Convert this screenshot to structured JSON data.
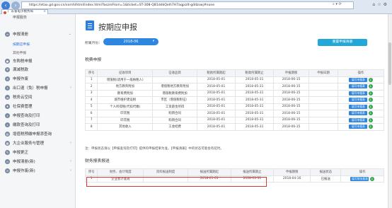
{
  "browser": {
    "url": "https://etax.gd.gov.cn/xxmh/html/index.html?bszmFrom=1&ticket=ST-308-Q81ddkQelh7H7aqpizlt-gddzswj#none",
    "tab_title": "广东省电子税务局",
    "back_icon": "back-arrow-icon",
    "forward_icon": "forward-arrow-icon"
  },
  "sidebar": {
    "top_label": "申报服务",
    "items": [
      {
        "label": "申报清册",
        "icon": "list-icon",
        "arrow": "⌄"
      },
      {
        "label": "按期应申报",
        "sub": true,
        "active": true
      },
      {
        "label": "其他申报",
        "sub": true,
        "active": false
      },
      {
        "label": "车购税申报",
        "icon": "car-icon"
      },
      {
        "label": "满减税款",
        "icon": "tax-icon"
      },
      {
        "label": "申报作废",
        "icon": "void-icon"
      },
      {
        "label": "出口退（免）税申报",
        "icon": "export-icon",
        "arrow": "›"
      },
      {
        "label": "税务云空间",
        "icon": "cloud-icon"
      },
      {
        "label": "社保费管理",
        "icon": "shield-icon"
      },
      {
        "label": "申报查询及打印",
        "icon": "search-icon"
      },
      {
        "label": "缴款查询及打印",
        "icon": "search-icon"
      },
      {
        "label": "增值税预缴申报添查询",
        "icon": "doc-icon"
      },
      {
        "label": "大企业服务与管理",
        "icon": "building-icon",
        "arrow": "›"
      },
      {
        "label": "申报更正",
        "icon": "edit-icon"
      },
      {
        "label": "申报清册(新)",
        "icon": "list-icon",
        "arrow": "›"
      },
      {
        "label": "申报作废(新)",
        "icon": "void-icon",
        "arrow": "›"
      }
    ]
  },
  "main": {
    "title": "按期应申报",
    "period_label": "所属月份：",
    "period_value": "2018-06",
    "period_arrow": "▾",
    "reset_button": "重置申报清册",
    "tax_section_title": "税费申报",
    "tax_table": {
      "headers": [
        "序号",
        "征收项目",
        "征收品目",
        "税款所属期起",
        "税款所属期止",
        "申报期限",
        "申报日期",
        "操作"
      ],
      "rows": [
        [
          "1",
          "增值税(适用于一般纳税人)",
          "",
          "2018-05-01",
          "2018-05-31",
          "2018-06-15",
          ""
        ],
        [
          "2",
          "地方教育附加",
          "增值税地方教育附加",
          "2018-05-01",
          "2018-05-31",
          "2018-06-15",
          ""
        ],
        [
          "3",
          "教育费附加",
          "增值税教育费附加",
          "2018-05-01",
          "2018-05-31",
          "2018-06-15",
          ""
        ],
        [
          "4",
          "城市维护建设税",
          "市区（增值税附征）",
          "2018-05-01",
          "2018-05-31",
          "2018-06-15",
          ""
        ],
        [
          "5",
          "个人所得税(代扣代缴)",
          "工资薪金所得",
          "2018-05-01",
          "2018-05-31",
          "2018-06-15",
          ""
        ],
        [
          "6",
          "印花税",
          "购销合同",
          "2018-05-01",
          "2018-05-31",
          "2018-06-15",
          ""
        ],
        [
          "7",
          "印花税",
          "购销合同",
          "2018-05-01",
          "2018-05-31",
          "2018-06-15",
          ""
        ],
        [
          "8",
          "其他收入",
          "工会经费",
          "2018-05-01",
          "2018-05-31",
          "2018-06-15",
          ""
        ]
      ],
      "action_label": "填写申报表"
    },
    "note": "注：申报状态请以【申报查询及打印】提供的申报结果为准，【申报清册】中的状态可能会有延时。",
    "fin_section_title": "财务报表报送",
    "fin_table": {
      "headers": [
        "序号",
        "财务、会计制度",
        "资料报送制度",
        "报送所属期起",
        "报送所属期止",
        "申报期限",
        "报送状态",
        "操作"
      ],
      "rows": [
        [
          "1",
          "企业会计准则",
          "",
          "2018-01-01",
          "2018-03-31",
          "2018-04-16",
          "已报送"
        ]
      ],
      "action_label": "填写财务报表"
    }
  }
}
